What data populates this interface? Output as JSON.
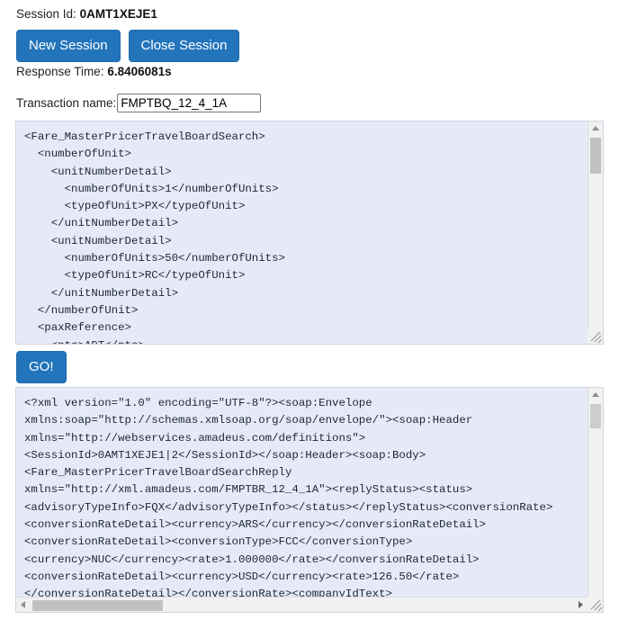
{
  "session": {
    "label": "Session Id:",
    "value": "0AMT1XEJE1"
  },
  "buttons": {
    "new_session": "New Session",
    "close_session": "Close Session",
    "go": "GO!"
  },
  "response_time": {
    "label": "Response Time:",
    "value": "6.8406081s"
  },
  "transaction": {
    "label": "Transaction name:",
    "value": "FMPTBQ_12_4_1A",
    "placeholder": ""
  },
  "request_textarea": {
    "name": "request-xml",
    "content": "<Fare_MasterPricerTravelBoardSearch>\n  <numberOfUnit>\n    <unitNumberDetail>\n      <numberOfUnits>1</numberOfUnits>\n      <typeOfUnit>PX</typeOfUnit>\n    </unitNumberDetail>\n    <unitNumberDetail>\n      <numberOfUnits>50</numberOfUnits>\n      <typeOfUnit>RC</typeOfUnit>\n    </unitNumberDetail>\n  </numberOfUnit>\n  <paxReference>\n    <ptc>ADT</ptc>"
  },
  "response_textarea": {
    "name": "response-xml",
    "content": "<?xml version=\"1.0\" encoding=\"UTF-8\"?><soap:Envelope\nxmlns:soap=\"http://schemas.xmlsoap.org/soap/envelope/\"><soap:Header\nxmlns=\"http://webservices.amadeus.com/definitions\">\n<SessionId>0AMT1XEJE1|2</SessionId></soap:Header><soap:Body>\n<Fare_MasterPricerTravelBoardSearchReply\nxmlns=\"http://xml.amadeus.com/FMPTBR_12_4_1A\"><replyStatus><status>\n<advisoryTypeInfo>FQX</advisoryTypeInfo></status></replyStatus><conversionRate>\n<conversionRateDetail><currency>ARS</currency></conversionRateDetail>\n<conversionRateDetail><conversionType>FCC</conversionType>\n<currency>NUC</currency><rate>1.000000</rate></conversionRateDetail>\n<conversionRateDetail><currency>USD</currency><rate>126.50</rate>\n</conversionRateDetail></conversionRate><companyIdText>"
  },
  "scrollbars": {
    "up_arrow_icon": "triangle-up-icon",
    "down_arrow_icon": "triangle-down-icon",
    "left_arrow_icon": "triangle-left-icon",
    "right_arrow_icon": "triangle-right-icon",
    "resize_grip_icon": "resize-grip-icon"
  },
  "colors": {
    "button_blue": "#2274bb",
    "textarea_bg": "#e6eaf8",
    "textarea_border": "#cfd4e4",
    "text": "#1e2733",
    "scrollbar_thumb": "#c1c1c1"
  }
}
